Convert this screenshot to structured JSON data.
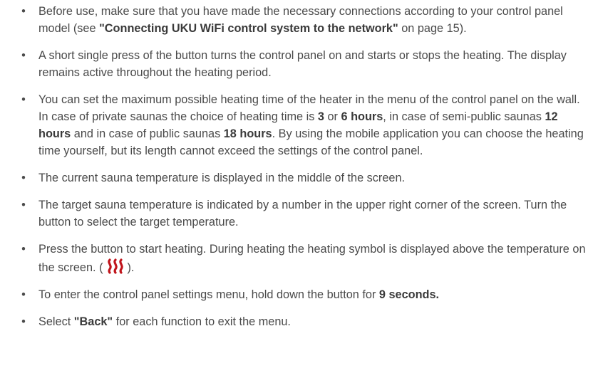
{
  "bullet_char": "•",
  "items": [
    {
      "p1": "Before use, make sure that you have made the necessary connections according to your control panel model (see ",
      "b1": "\"Connecting UKU WiFi control system to the network\"",
      "p2": " on page 15)."
    },
    {
      "p1": "A short single press of the button turns the control panel on and starts or stops the heating. The display remains active throughout the heating period."
    },
    {
      "p1": "You can set the maximum possible heating time of the heater in the menu of the control panel on the wall. In case of private saunas the choice of heating time is ",
      "b1": "3",
      "p2": " or ",
      "b2": "6 hours",
      "p3": ", in case of semi-public saunas ",
      "b3": "12 hours",
      "p4": " and in case of public saunas ",
      "b4": "18 hours",
      "p5": ". By using the mobile application you can choose the heating time yourself, but its length cannot exceed the settings of the control panel."
    },
    {
      "p1": "The current sauna temperature is displayed in the middle of the screen."
    },
    {
      "p1": "The target sauna temperature is indicated by a number in the upper right corner of the screen. Turn the button to select the target temperature."
    },
    {
      "p1": "Press the button to start heating. During heating the heating symbol is displayed above the temperature on the screen. (",
      "icon": "heating-symbol-icon",
      "p2": ")."
    },
    {
      "p1": "To enter the control panel settings menu, hold down the button for ",
      "b1": "9 seconds."
    },
    {
      "p1": "Select ",
      "b1": "\"Back\"",
      "p2": " for each function to exit the menu."
    }
  ],
  "colors": {
    "text": "#4a4a4a",
    "heat_icon": "#c0141b"
  }
}
